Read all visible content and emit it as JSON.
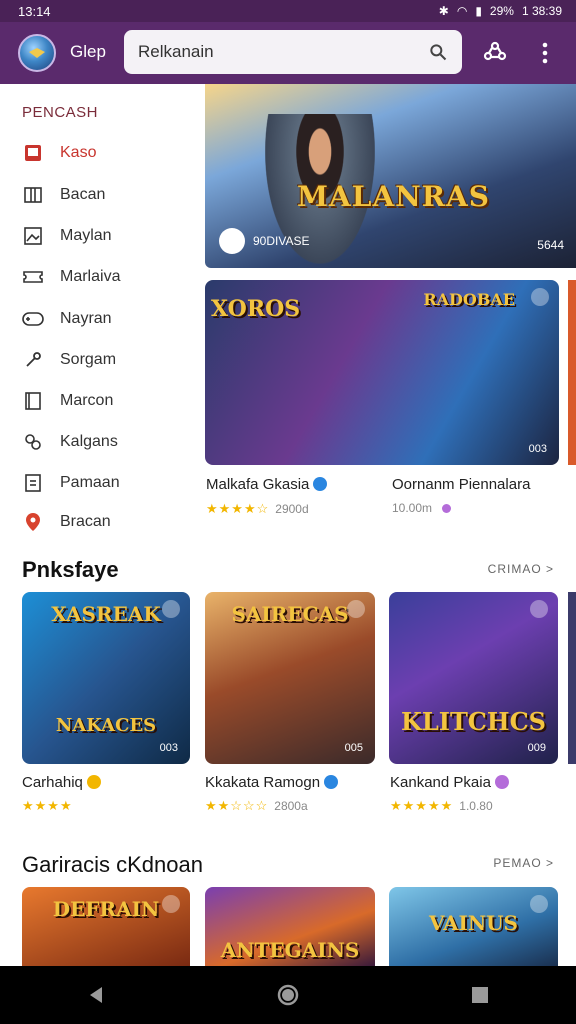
{
  "status": {
    "time": "13:14",
    "battery": "29%",
    "right_time": "1 38:39"
  },
  "appbar": {
    "app_name": "Glep",
    "search_value": "Relkanain"
  },
  "drawer": {
    "title": "PENCASH",
    "items": [
      {
        "label": "Kaso",
        "icon": "flag-icon"
      },
      {
        "label": "Bacan",
        "icon": "columns-icon"
      },
      {
        "label": "Maylan",
        "icon": "image-icon"
      },
      {
        "label": "Marlaiva",
        "icon": "ticket-icon"
      },
      {
        "label": "Nayran",
        "icon": "gamepad-icon"
      },
      {
        "label": "Sorgam",
        "icon": "wrench-icon"
      },
      {
        "label": "Marcon",
        "icon": "book-icon"
      },
      {
        "label": "Kalgans",
        "icon": "link-icon"
      },
      {
        "label": "Pamaan",
        "icon": "document-icon"
      },
      {
        "label": "Bracan",
        "icon": "pin-icon"
      }
    ]
  },
  "banner": {
    "title": "MALANRAS",
    "left_caption": "90DIVASE",
    "right_caption": "5644"
  },
  "featured": [
    {
      "card_title": "XOROS",
      "card_title2": "RADOBAE",
      "badge": "003",
      "name": "Malkafa Gkasia",
      "meta": "2900d",
      "stars": "★★★★☆"
    },
    {
      "name": "Oornanm Piennalara",
      "meta": "10.00m"
    }
  ],
  "section1": {
    "title": "Pnksfaye",
    "more": "CRIMAO >",
    "cards": [
      {
        "title": "XASREAK",
        "title2": "NAKACES",
        "badge": "003",
        "name": "Carhahiq",
        "stars": "★★★★",
        "meta": ""
      },
      {
        "title": "SAIRECAS",
        "title2": "",
        "badge": "005",
        "name": "Kkakata Ramogn",
        "stars": "★★☆☆☆",
        "meta": "2800a"
      },
      {
        "title": "",
        "title2": "KLITCHCS",
        "badge": "009",
        "name": "Kankand Pkaia",
        "stars": "★★★★★",
        "meta": "1.0.80"
      }
    ]
  },
  "section2": {
    "title": "Gariracis cKdnoan",
    "more": "PEMAO >",
    "cards": [
      {
        "title": "DEFRAIN"
      },
      {
        "title": "ANTEGAINS"
      },
      {
        "title": "VAINUS"
      }
    ]
  },
  "colors": {
    "appbar": "#5a2a6c",
    "accent_red": "#c8352e",
    "star": "#f2b600",
    "verified_blue": "#2a86e0"
  }
}
